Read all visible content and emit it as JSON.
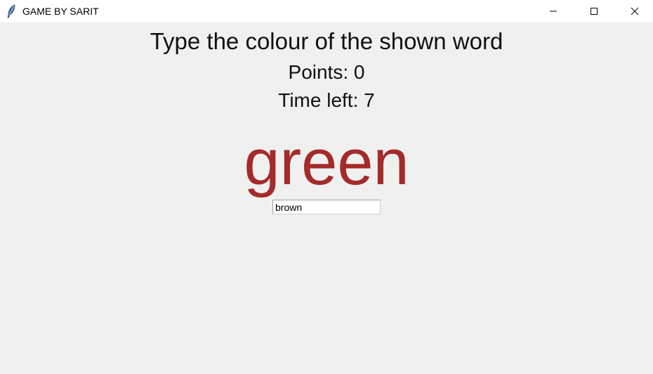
{
  "window": {
    "title": "GAME BY SARIT",
    "icon": "feather-icon",
    "controls": [
      "minimize-icon",
      "maximize-icon",
      "close-icon"
    ]
  },
  "game": {
    "instruction": "Type the colour of the shown word",
    "points": "Points: 0",
    "time_left": "Time left: 7",
    "word": "green",
    "word_color": "#a52a2a",
    "entry_value": "brown"
  }
}
